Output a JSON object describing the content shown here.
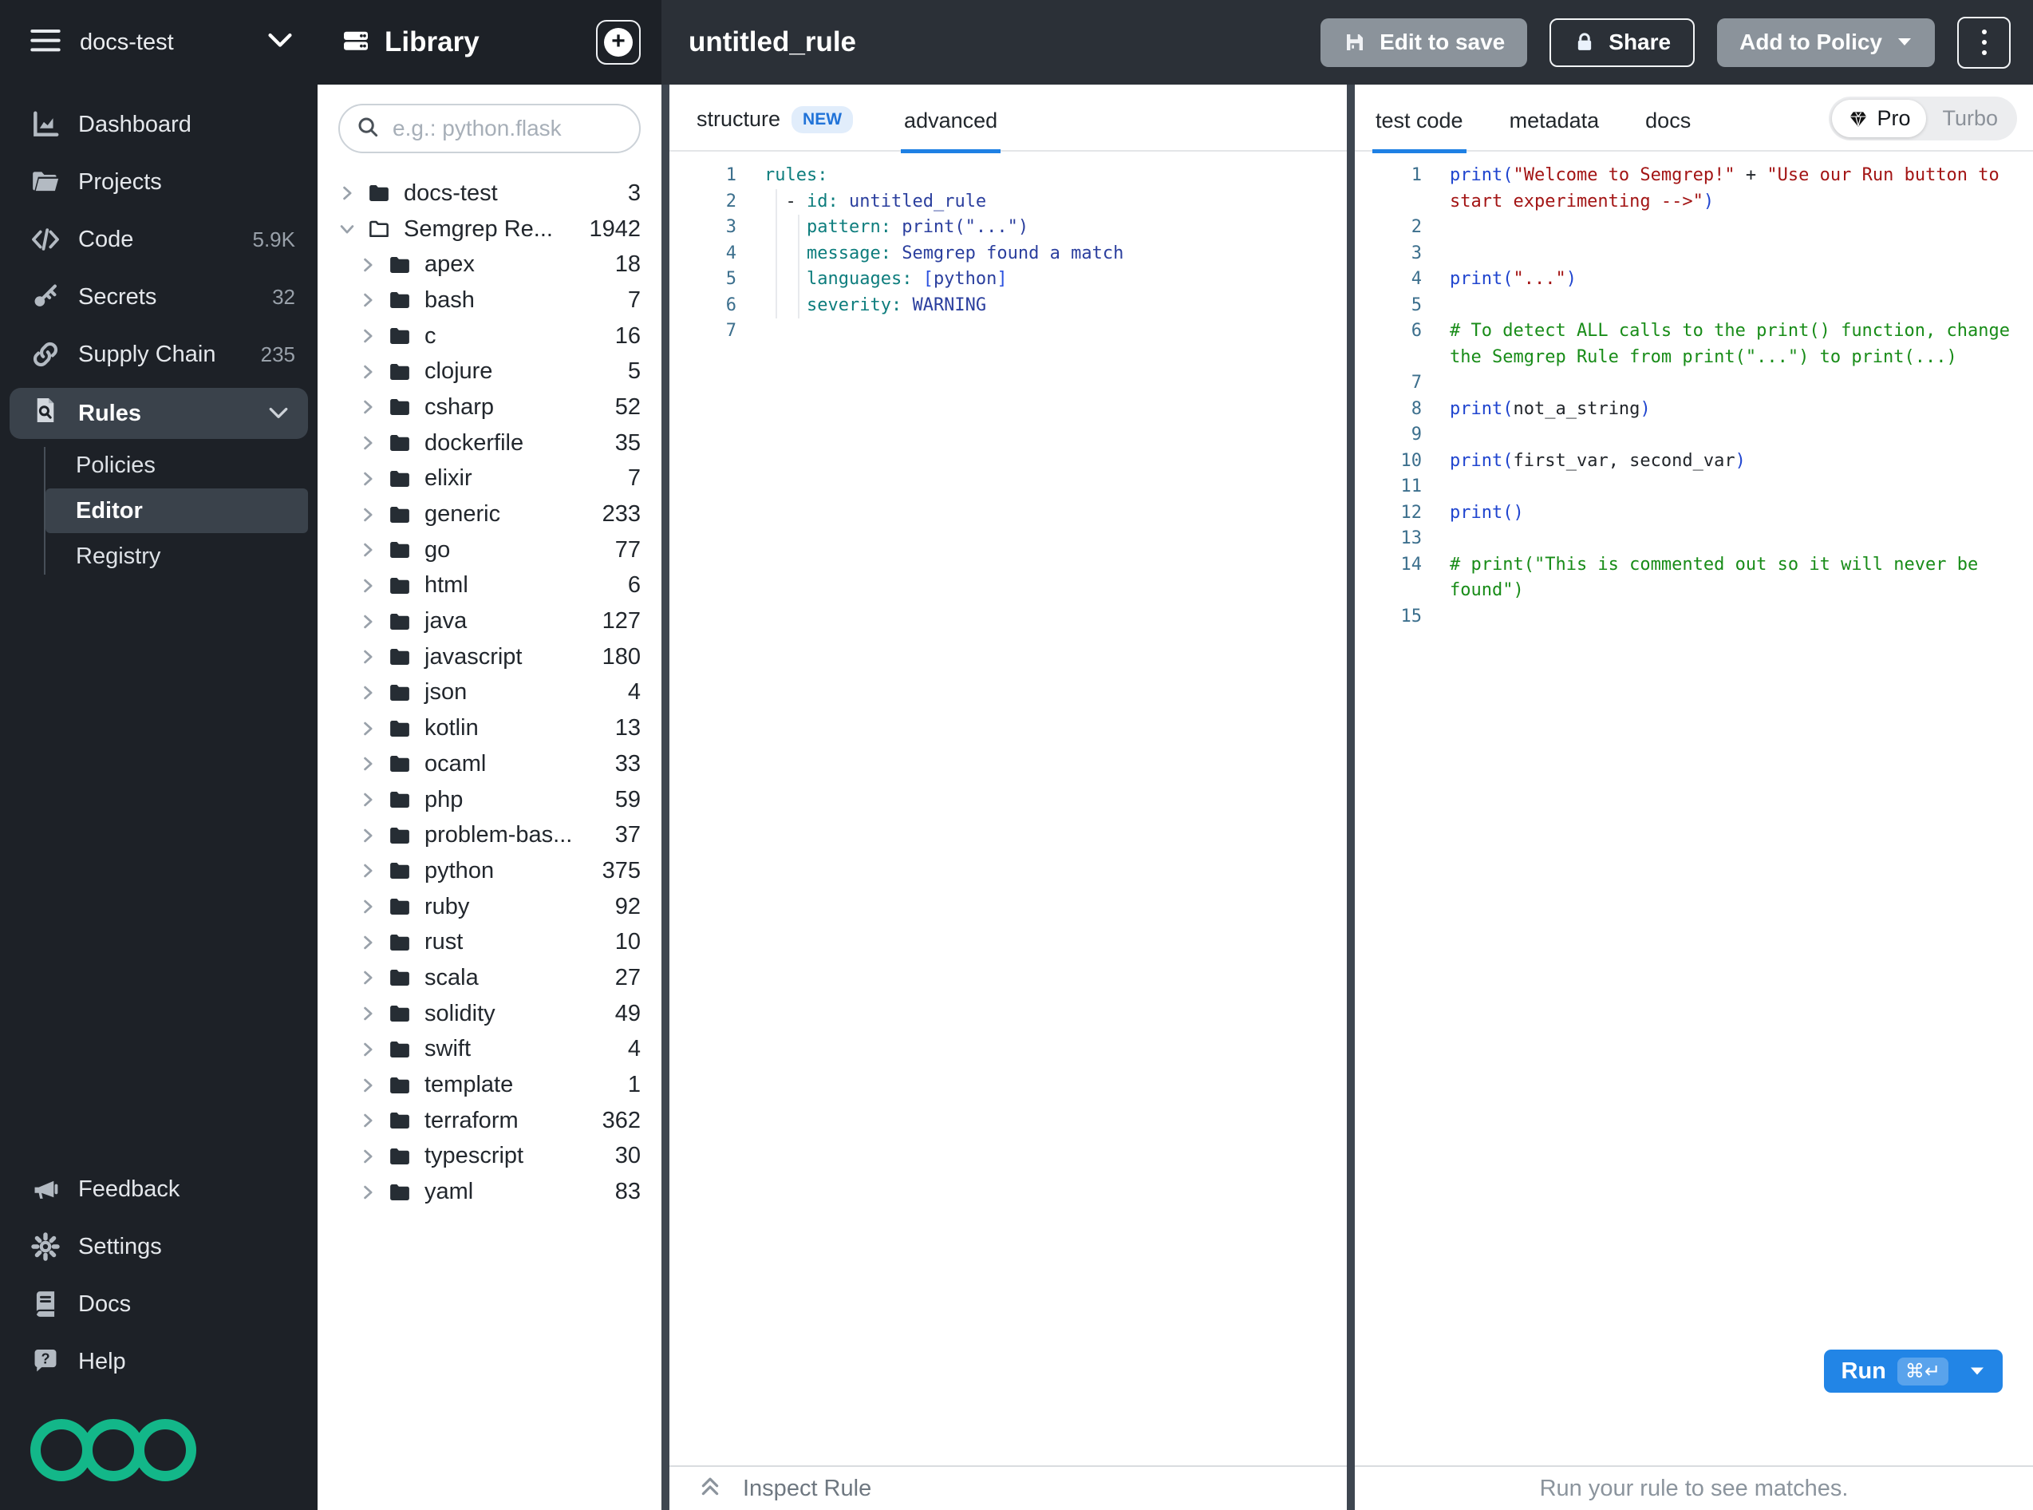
{
  "org": {
    "name": "docs-test"
  },
  "sidebar": {
    "nav": [
      {
        "label": "Dashboard",
        "icon": "chart-icon",
        "badge": ""
      },
      {
        "label": "Projects",
        "icon": "folder-open-icon",
        "badge": ""
      },
      {
        "label": "Code",
        "icon": "code-icon",
        "badge": "5.9K"
      },
      {
        "label": "Secrets",
        "icon": "key-icon",
        "badge": "32"
      },
      {
        "label": "Supply Chain",
        "icon": "link-icon",
        "badge": "235"
      },
      {
        "label": "Rules",
        "icon": "rule-search-icon",
        "badge": ""
      }
    ],
    "rules_children": [
      {
        "label": "Policies",
        "active": false
      },
      {
        "label": "Editor",
        "active": true
      },
      {
        "label": "Registry",
        "active": false
      }
    ],
    "footer": [
      {
        "label": "Feedback",
        "icon": "megaphone-icon"
      },
      {
        "label": "Settings",
        "icon": "gear-icon"
      },
      {
        "label": "Docs",
        "icon": "book-icon"
      },
      {
        "label": "Help",
        "icon": "help-bubble-icon"
      }
    ]
  },
  "library": {
    "title": "Library",
    "search_placeholder": "e.g.: python.flask",
    "tree": [
      {
        "label": "docs-test",
        "count": "3",
        "depth": 0,
        "expanded": false
      },
      {
        "label": "Semgrep Re...",
        "count": "1942",
        "depth": 0,
        "expanded": true
      },
      {
        "label": "apex",
        "count": "18",
        "depth": 1,
        "expanded": false
      },
      {
        "label": "bash",
        "count": "7",
        "depth": 1,
        "expanded": false
      },
      {
        "label": "c",
        "count": "16",
        "depth": 1,
        "expanded": false
      },
      {
        "label": "clojure",
        "count": "5",
        "depth": 1,
        "expanded": false
      },
      {
        "label": "csharp",
        "count": "52",
        "depth": 1,
        "expanded": false
      },
      {
        "label": "dockerfile",
        "count": "35",
        "depth": 1,
        "expanded": false
      },
      {
        "label": "elixir",
        "count": "7",
        "depth": 1,
        "expanded": false
      },
      {
        "label": "generic",
        "count": "233",
        "depth": 1,
        "expanded": false
      },
      {
        "label": "go",
        "count": "77",
        "depth": 1,
        "expanded": false
      },
      {
        "label": "html",
        "count": "6",
        "depth": 1,
        "expanded": false
      },
      {
        "label": "java",
        "count": "127",
        "depth": 1,
        "expanded": false
      },
      {
        "label": "javascript",
        "count": "180",
        "depth": 1,
        "expanded": false
      },
      {
        "label": "json",
        "count": "4",
        "depth": 1,
        "expanded": false
      },
      {
        "label": "kotlin",
        "count": "13",
        "depth": 1,
        "expanded": false
      },
      {
        "label": "ocaml",
        "count": "33",
        "depth": 1,
        "expanded": false
      },
      {
        "label": "php",
        "count": "59",
        "depth": 1,
        "expanded": false
      },
      {
        "label": "problem-bas...",
        "count": "37",
        "depth": 1,
        "expanded": false
      },
      {
        "label": "python",
        "count": "375",
        "depth": 1,
        "expanded": false
      },
      {
        "label": "ruby",
        "count": "92",
        "depth": 1,
        "expanded": false
      },
      {
        "label": "rust",
        "count": "10",
        "depth": 1,
        "expanded": false
      },
      {
        "label": "scala",
        "count": "27",
        "depth": 1,
        "expanded": false
      },
      {
        "label": "solidity",
        "count": "49",
        "depth": 1,
        "expanded": false
      },
      {
        "label": "swift",
        "count": "4",
        "depth": 1,
        "expanded": false
      },
      {
        "label": "template",
        "count": "1",
        "depth": 1,
        "expanded": false
      },
      {
        "label": "terraform",
        "count": "362",
        "depth": 1,
        "expanded": false
      },
      {
        "label": "typescript",
        "count": "30",
        "depth": 1,
        "expanded": false
      },
      {
        "label": "yaml",
        "count": "83",
        "depth": 1,
        "expanded": false
      }
    ]
  },
  "editor_pane": {
    "title": "untitled_rule",
    "actions": {
      "edit_to_save": "Edit to save",
      "share": "Share",
      "add_to_policy": "Add to Policy"
    },
    "tabs": {
      "structure": "structure",
      "new_badge": "NEW",
      "advanced": "advanced"
    },
    "code": [
      {
        "n": "1",
        "tokens": [
          [
            "key",
            "rules:"
          ]
        ]
      },
      {
        "n": "2",
        "tokens": [
          [
            "plain",
            "  - "
          ],
          [
            "key",
            "id:"
          ],
          [
            "val",
            " untitled_rule"
          ]
        ]
      },
      {
        "n": "3",
        "tokens": [
          [
            "plain",
            "    "
          ],
          [
            "key",
            "pattern:"
          ],
          [
            "val",
            " print(\"...\")"
          ]
        ]
      },
      {
        "n": "4",
        "tokens": [
          [
            "plain",
            "    "
          ],
          [
            "key",
            "message:"
          ],
          [
            "val",
            " Semgrep found a match"
          ]
        ]
      },
      {
        "n": "5",
        "tokens": [
          [
            "plain",
            "    "
          ],
          [
            "key",
            "languages:"
          ],
          [
            "val",
            " "
          ],
          [
            "brk",
            "["
          ],
          [
            "val",
            "python"
          ],
          [
            "brk",
            "]"
          ]
        ]
      },
      {
        "n": "6",
        "tokens": [
          [
            "plain",
            "    "
          ],
          [
            "key",
            "severity:"
          ],
          [
            "val",
            " WARNING"
          ]
        ]
      },
      {
        "n": "7",
        "tokens": []
      }
    ]
  },
  "test_pane": {
    "tabs": {
      "test_code": "test code",
      "metadata": "metadata",
      "docs": "docs"
    },
    "engine_toggle": {
      "pro": "Pro",
      "turbo": "Turbo"
    },
    "code": [
      {
        "n": "1",
        "tokens": [
          [
            "blue",
            "print("
          ],
          [
            "str",
            "\"Welcome to Semgrep!\""
          ],
          [
            "plain",
            " + "
          ],
          [
            "str",
            "\"Use our Run button to start experimenting -->\""
          ],
          [
            "blue",
            ")"
          ]
        ]
      },
      {
        "n": "2",
        "tokens": []
      },
      {
        "n": "3",
        "tokens": []
      },
      {
        "n": "4",
        "tokens": [
          [
            "blue",
            "print("
          ],
          [
            "str",
            "\"...\""
          ],
          [
            "blue",
            ")"
          ]
        ]
      },
      {
        "n": "5",
        "tokens": []
      },
      {
        "n": "6",
        "tokens": [
          [
            "com",
            "# To detect ALL calls to the print() function, change the Semgrep Rule from print(\"...\") to print(...)"
          ]
        ]
      },
      {
        "n": "7",
        "tokens": []
      },
      {
        "n": "8",
        "tokens": [
          [
            "blue",
            "print("
          ],
          [
            "plain",
            "not_a_string"
          ],
          [
            "blue",
            ")"
          ]
        ]
      },
      {
        "n": "9",
        "tokens": []
      },
      {
        "n": "10",
        "tokens": [
          [
            "blue",
            "print("
          ],
          [
            "plain",
            "first_var, second_var"
          ],
          [
            "blue",
            ")"
          ]
        ]
      },
      {
        "n": "11",
        "tokens": []
      },
      {
        "n": "12",
        "tokens": [
          [
            "blue",
            "print()"
          ]
        ]
      },
      {
        "n": "13",
        "tokens": []
      },
      {
        "n": "14",
        "tokens": [
          [
            "com",
            "# print(\"This is commented out so it will never be found\")"
          ]
        ]
      },
      {
        "n": "15",
        "tokens": []
      }
    ],
    "run": {
      "label": "Run",
      "shortcut": "⌘↵"
    },
    "status": "Run your rule to see matches."
  },
  "inspect_bar": {
    "label": "Inspect Rule"
  },
  "colors": {
    "accent_blue": "#1e80e4",
    "run_blue": "#2285e6",
    "sidebar_bg": "#1d2127",
    "header_bg": "#2b3037",
    "divider": "#3e4650",
    "logo_green": "#13b789",
    "yaml_key": "#0d7d7d",
    "yaml_value": "#2b3f9e",
    "py_builtin": "#2045cf",
    "py_string": "#a31515",
    "py_comment": "#188c18"
  }
}
